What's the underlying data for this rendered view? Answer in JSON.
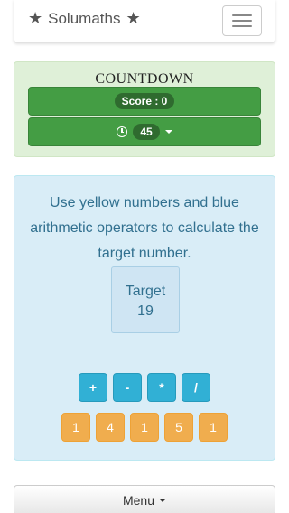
{
  "header": {
    "brand": "Solumaths",
    "menu_toggle_icon": "hamburger-icon"
  },
  "game": {
    "title": "COUNTDOWN",
    "score_label": "Score : 0",
    "timer_value": "45",
    "timer_icon": "clock-icon"
  },
  "puzzle": {
    "instructions": "Use yellow numbers and blue arithmetic operators to calculate the target number.",
    "target_label": "Target",
    "target_value": "19",
    "operators": [
      "+",
      "-",
      "*",
      "/"
    ],
    "numbers": [
      "1",
      "4",
      "1",
      "5",
      "1"
    ]
  },
  "footer": {
    "menu_label": "Menu"
  },
  "colors": {
    "success": "#449d44",
    "info": "#31b0d5",
    "warning": "#f0ad4e",
    "info_text": "#31708f"
  }
}
